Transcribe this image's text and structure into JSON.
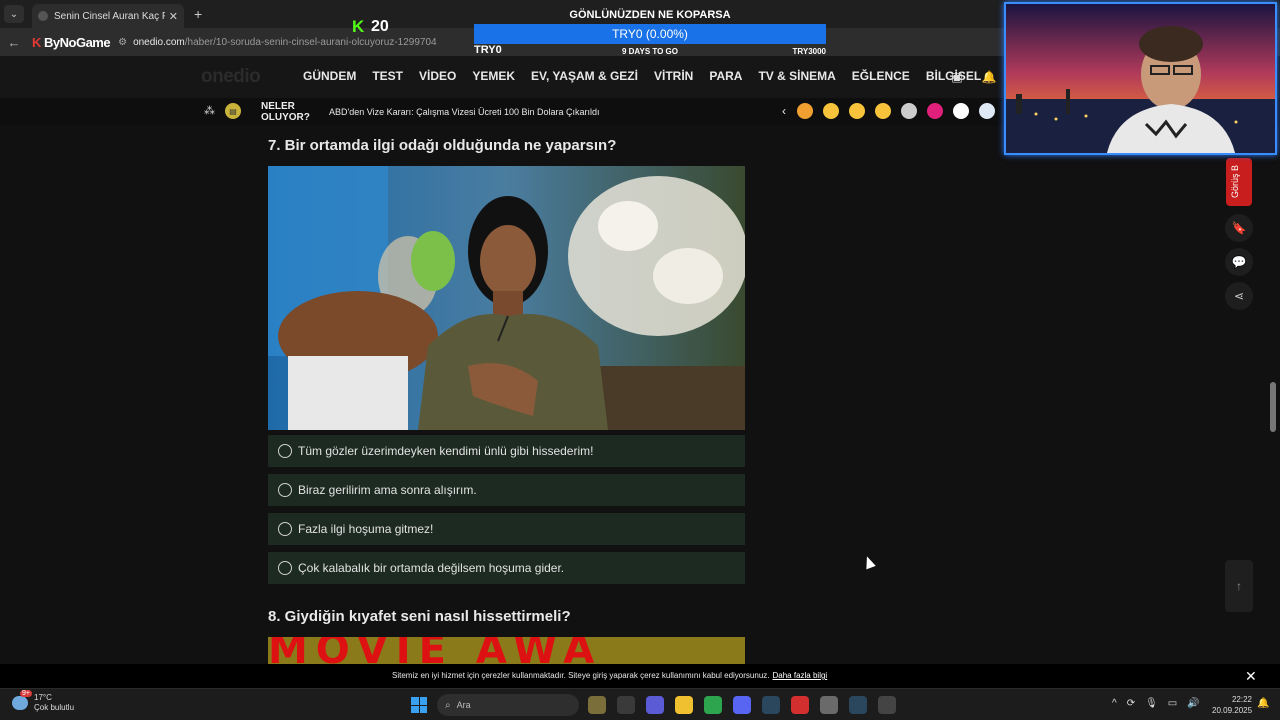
{
  "browser": {
    "tab_title": "Senin Cinsel Auran Kaç Puan! -",
    "url_domain": "onedio.com",
    "url_path": "/haber/10-soruda-senin-cinsel-aurani-olcuyoruz-1299704",
    "brand": "ByNoGame"
  },
  "site": {
    "logo": "onedio",
    "nav": [
      "GÜNDEM",
      "TEST",
      "VİDEO",
      "YEMEK",
      "EV, YAŞAM & GEZİ",
      "VİTRİN",
      "PARA",
      "TV & SİNEMA",
      "EĞLENCE",
      "BİLGİSEL"
    ]
  },
  "newsbar": {
    "label_line1": "NELER",
    "label_line2": "OLUYOR?",
    "headline": "ABD'den Vize Kararı: Çalışma Vizesi Ücreti 100 Bin Dolara Çıkarıldı",
    "reaction_colors": [
      "#f0a030",
      "#f6c33a",
      "#f6c33a",
      "#f6c33a",
      "#cccccc",
      "#e0207a",
      "#ffffff",
      "#dfe8f5"
    ]
  },
  "quiz": {
    "q7": "7. Bir ortamda ilgi odağı olduğunda ne yaparsın?",
    "q7_options": [
      "Tüm gözler üzerimdeyken kendimi ünlü gibi hissederim!",
      "Biraz gerilirim ama sonra alışırım.",
      "Fazla ilgi hoşuma gitmez!",
      "Çok kalabalık bir ortamda değilsem hoşuma gider."
    ],
    "q8": "8. Giydiğin kıyafet seni nasıl hissettirmeli?",
    "q8_image_text": "MOVIE AWA"
  },
  "side": {
    "red_tab": "Görüş B"
  },
  "cookie": {
    "message": "Sitemiz en iyi hizmet için çerezler kullanmaktadır. Siteye giriş yaparak çerez kullanımını kabul ediyorsunuz.",
    "link": "Daha fazla bilgi"
  },
  "taskbar": {
    "temp": "17°C",
    "weather": "Çok bulutlu",
    "weather_badge": "9+",
    "search_placeholder": "Ara",
    "time": "22:22",
    "date": "20.09.2025",
    "app_colors": [
      "#7a6f3a",
      "#3a3a3a",
      "#5b5bd6",
      "#f0c030",
      "#2da44e",
      "#5865f2",
      "#2a475e",
      "#d32f2f",
      "#6a6a6a",
      "#2a475e",
      "#444444"
    ]
  },
  "overlay": {
    "kick_count": "20",
    "goal_title": "GÖNLÜNÜZDEN NE KOPARSA",
    "goal_progress": "TRY0 (0.00%)",
    "goal_progress_fraction": 0,
    "goal_start": "TRY0",
    "goal_days": "9 DAYS TO GO",
    "goal_target": "TRY3000"
  }
}
